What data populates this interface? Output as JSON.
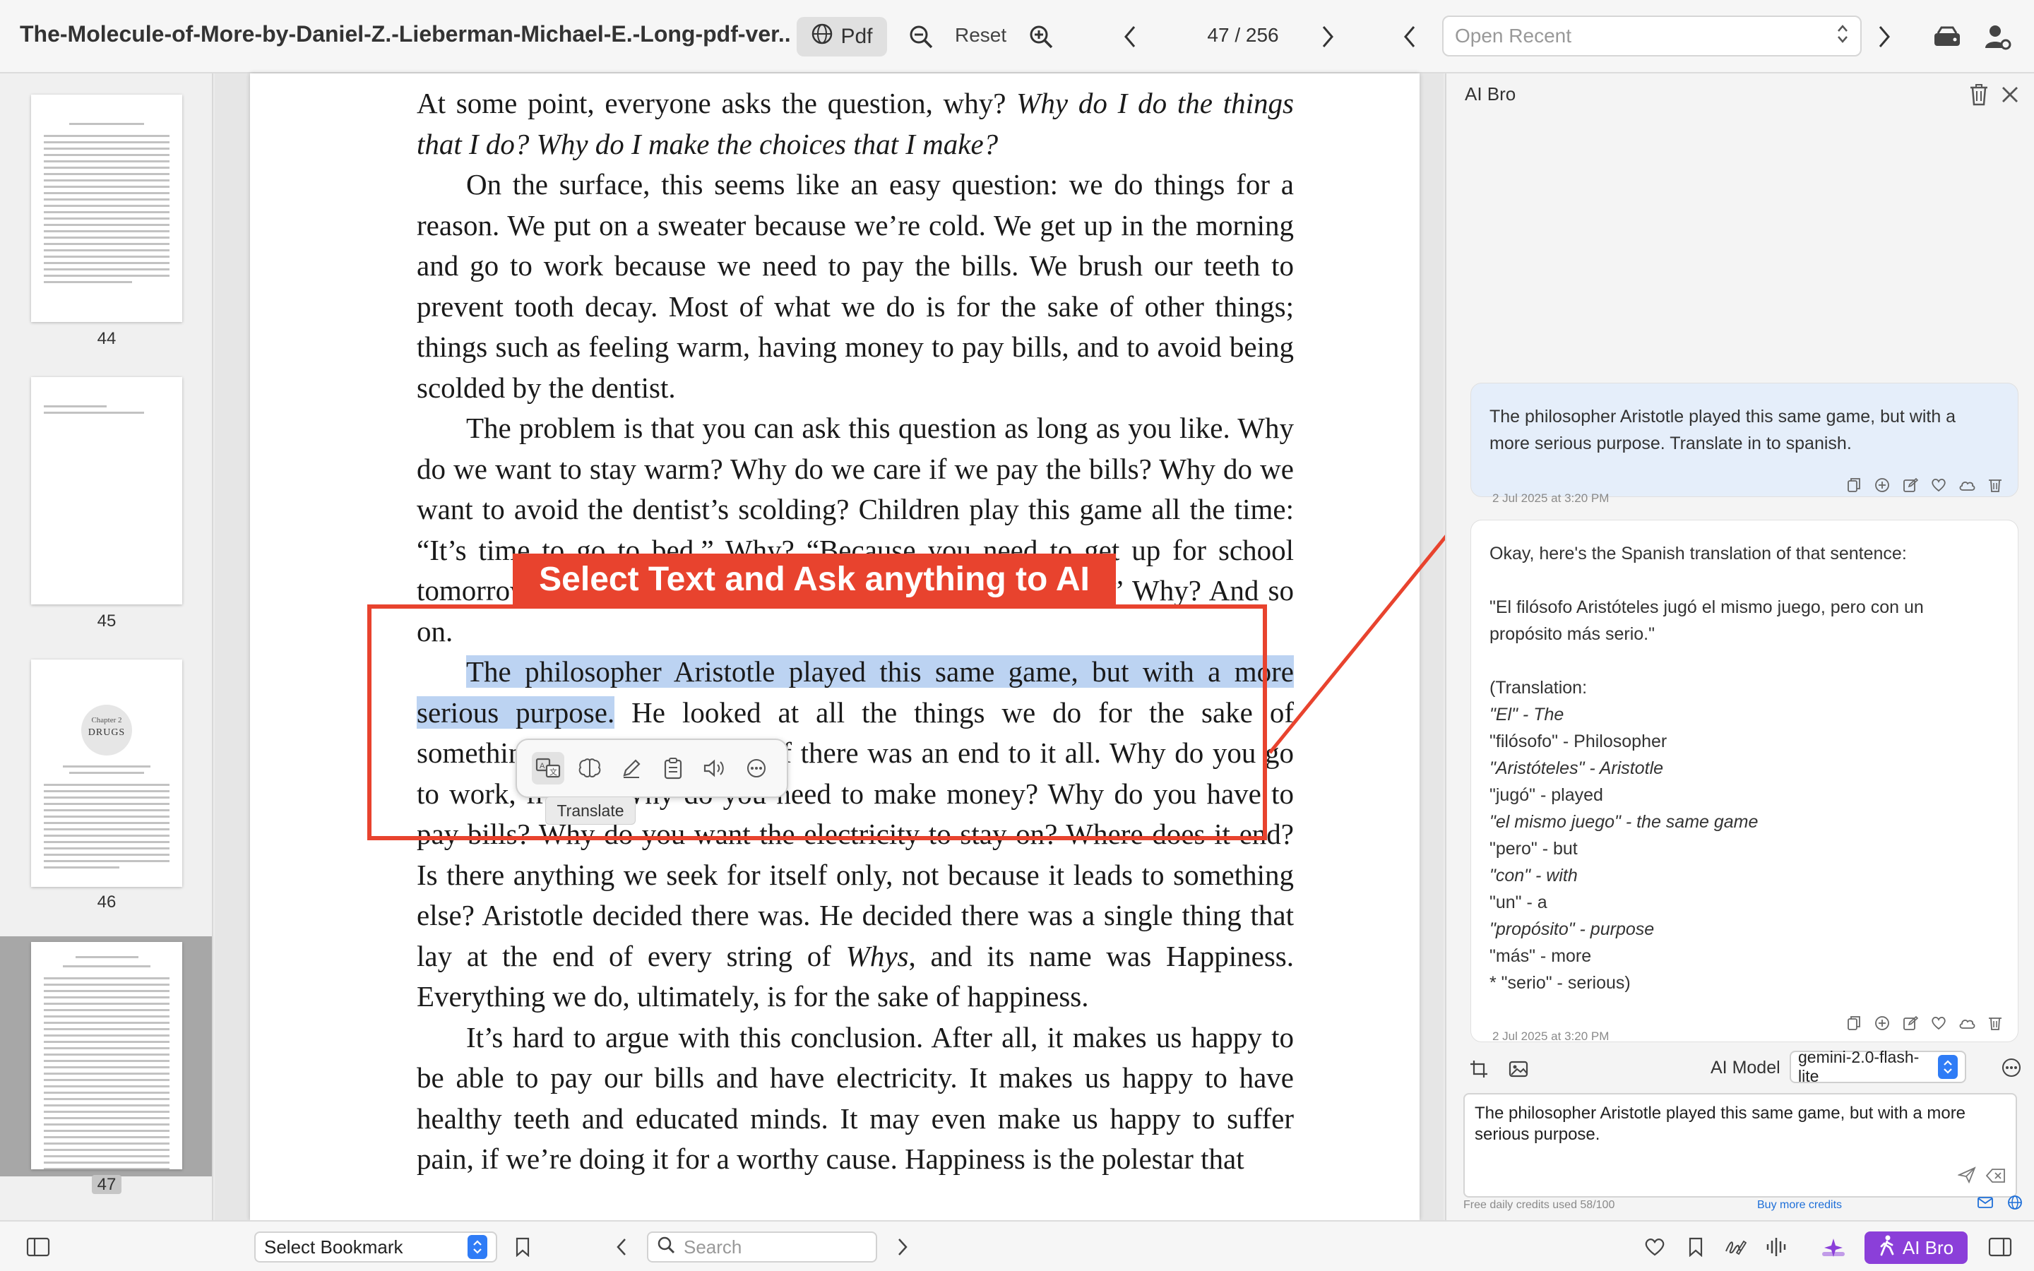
{
  "toolbar": {
    "doc_title": "The-Molecule-of-More-by-Daniel-Z.-Lieberman-Michael-E.-Long-pdf-ver...",
    "pdf_label": "Pdf",
    "reset_label": "Reset",
    "page_indicator": "47 / 256",
    "open_recent_placeholder": "Open Recent"
  },
  "sidebar": {
    "thumbnails": [
      {
        "label": "44"
      },
      {
        "label": "45"
      },
      {
        "label": "46",
        "chapter_label": "Chapter 2",
        "chapter_title": "DRUGS"
      },
      {
        "label": "47"
      }
    ]
  },
  "page": {
    "paragraphs": [
      {
        "text_a": "At some point, everyone asks the question, why? ",
        "text_i": "Why do I do the things that I do? Why do I make the choices that I make?"
      },
      {
        "text": "On the surface, this seems like an easy question: we do things for a reason. We put on a sweater because we’re cold. We get up in the morning and go to work because we need to pay the bills. We brush our teeth to prevent tooth decay. Most of what we do is for the sake of other things; things such as feeling warm, having money to pay bills, and to avoid being scolded by the dentist."
      },
      {
        "text": "The problem is that you can ask this question as long as you like. Why do we want to stay warm? Why do we care if we pay the bills? Why do we want to avoid the dentist’s scolding? Children play this game all the time: “It’s time to go to bed.” Why? “Because you need to get up for school tomorrow.” Why? “So you can learn and get an education.” Why? And so on."
      },
      {
        "highlight": "The philosopher Aristotle played this same game, but with a more serious purpose.",
        "text": " He looked at all the things we do for the sake of something else and wondered if there was an end to it all. Why do you go to work, friend? Why do you need to make money? Why do you have to pay bills? Why do you want the electricity to stay on? Where does it end? Is there anything we seek for itself only, not because it leads to something else? Aristotle decided there was. He decided there was a single thing that lay at the end of every string of "
      },
      {
        "text": "It’s hard to argue with this conclusion. After all, it makes us happy to be able to pay our bills and have electricity. It makes us happy to have healthy teeth and educated minds. It may even make us happy to suffer pain, if we’re doing it for a worthy cause. Happiness is the polestar that"
      }
    ],
    "whys_italic": "Whys",
    "after_whys": ", and its name was Happiness. Everything we do, ultimately, is for the sake of happiness."
  },
  "annotation": {
    "callout": "Select Text and Ask anything to AI",
    "tooltip": "Translate"
  },
  "ai_panel": {
    "title": "AI Bro",
    "user_message": "The philosopher Aristotle played this same game, but with a more serious purpose. Translate in to spanish.",
    "user_timestamp": "2 Jul 2025 at 3:20 PM",
    "bot_lines": [
      {
        "t": "Okay, here's the Spanish translation of that sentence:",
        "i": false
      },
      {
        "t": "",
        "i": false
      },
      {
        "t": "\"El filósofo Aristóteles jugó el mismo juego, pero con un propósito más serio.\"",
        "i": false
      },
      {
        "t": "",
        "i": false
      },
      {
        "t": "(Translation:",
        "i": false
      },
      {
        "t": "\"El\" - The",
        "i": true
      },
      {
        "t": "\"filósofo\" - Philosopher",
        "i": false
      },
      {
        "t": "\"Aristóteles\" - Aristotle",
        "i": true
      },
      {
        "t": "\"jugó\" - played",
        "i": false
      },
      {
        "t": "\"el mismo juego\" - the same game",
        "i": true
      },
      {
        "t": "\"pero\" - but",
        "i": false
      },
      {
        "t": "\"con\" - with",
        "i": true
      },
      {
        "t": "\"un\" - a",
        "i": false
      },
      {
        "t": "\"propósito\" - purpose",
        "i": true
      },
      {
        "t": "\"más\" - more",
        "i": false
      },
      {
        "t": "* \"serio\" - serious)",
        "i": false
      }
    ],
    "bot_timestamp": "2 Jul 2025 at 3:20 PM",
    "model_label": "AI Model",
    "model_value": "gemini-2.0-flash-lite",
    "input_value": "The philosopher Aristotle played this same game, but with a more serious purpose.",
    "credits": "Free daily credits used 58/100",
    "buy_credits": "Buy more credits"
  },
  "bottombar": {
    "bookmark_value": "Select Bookmark",
    "search_placeholder": "Search",
    "ai_bro_label": "AI Bro"
  },
  "colors": {
    "accent_red": "#e8432e",
    "highlight": "#bcd3f2",
    "ai_bro_purple": "#8b3fd9",
    "select_blue": "#2f7cf6"
  }
}
